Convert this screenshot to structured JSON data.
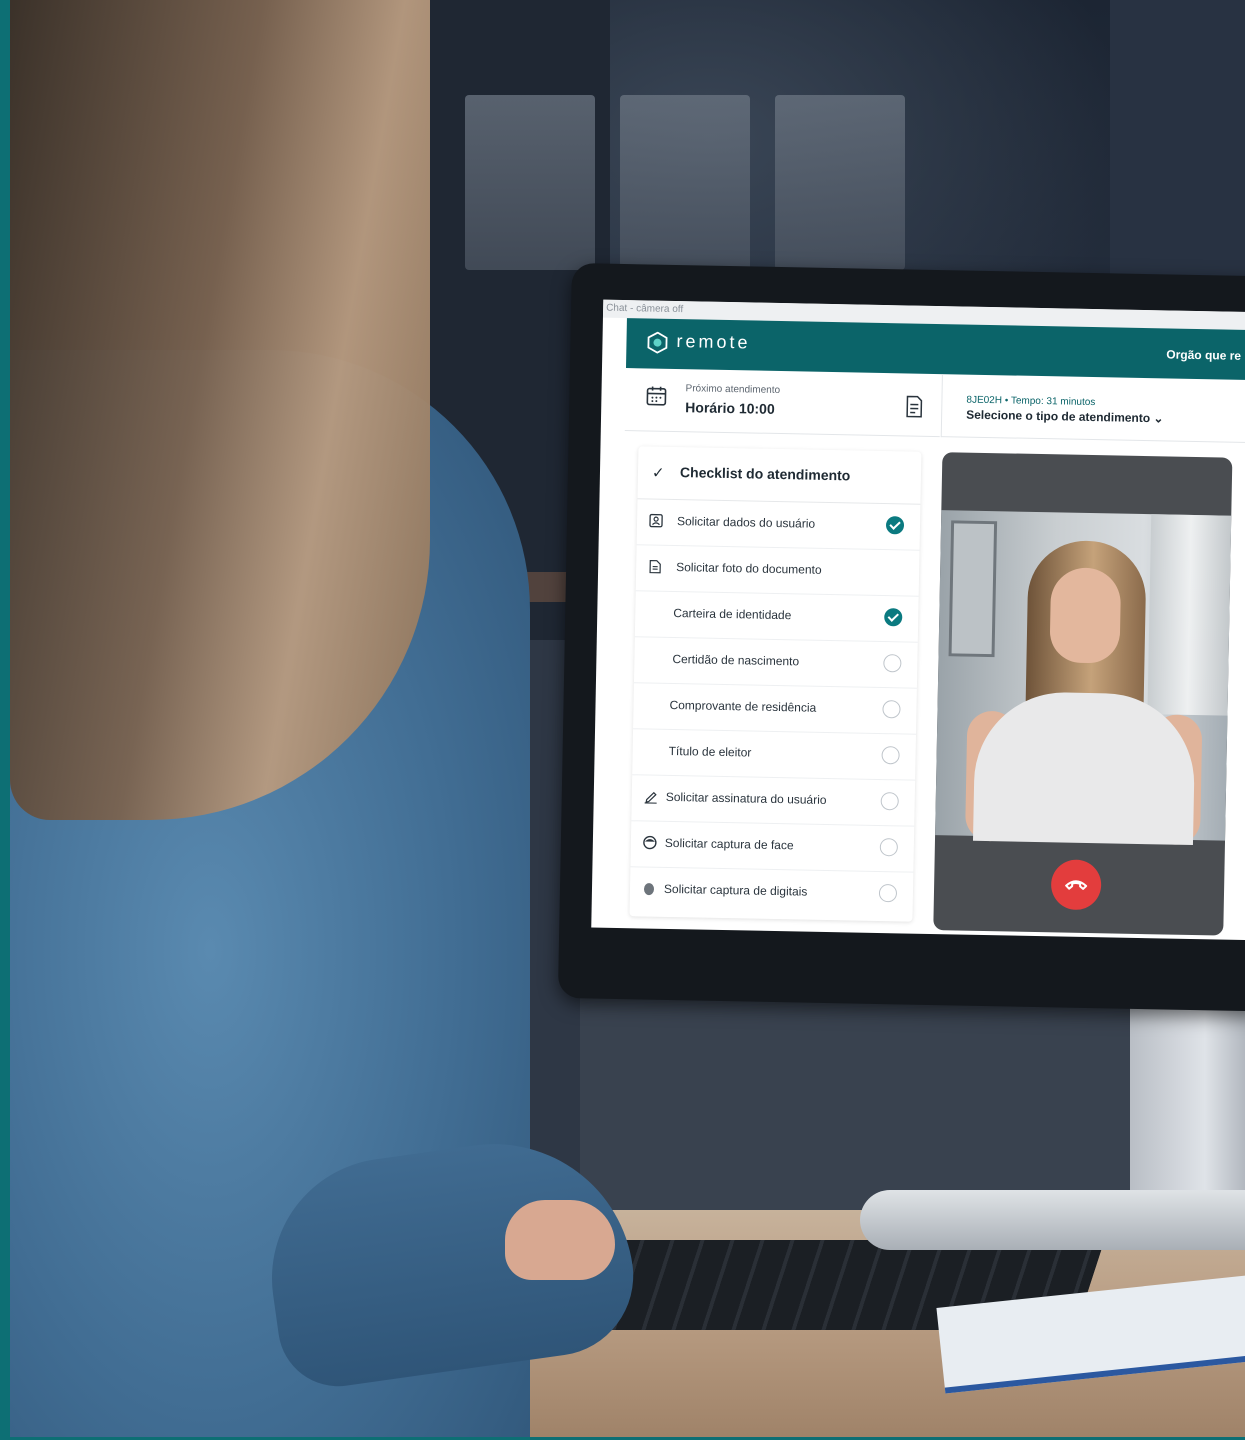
{
  "window": {
    "title": "Chat - câmera off"
  },
  "app": {
    "brand": "remote",
    "org_label": "Orgão que re",
    "accent_color": "#0b6469",
    "check_color": "#0b7a80",
    "hangup_color": "#e33d3d"
  },
  "next_appointment": {
    "label": "Próximo atendimento",
    "value": "Horário 10:00"
  },
  "session": {
    "info": "8JE02H • Tempo: 31 minutos",
    "type_select": "Selecione o tipo de atendimento ⌄"
  },
  "checklist": {
    "title": "Checklist do atendimento",
    "items": [
      {
        "label": "Solicitar dados do usuário",
        "icon": "user-card-icon",
        "checked": true
      },
      {
        "label": "Solicitar foto do documento",
        "icon": "document-icon",
        "checked": null
      },
      {
        "label": "Carteira de identidade",
        "icon": "",
        "checked": true
      },
      {
        "label": "Certidão de nascimento",
        "icon": "",
        "checked": false
      },
      {
        "label": "Comprovante de residência",
        "icon": "",
        "checked": false
      },
      {
        "label": "Título de eleitor",
        "icon": "",
        "checked": false
      },
      {
        "label": "Solicitar assinatura do usuário",
        "icon": "pen-icon",
        "checked": false
      },
      {
        "label": "Solicitar captura de face",
        "icon": "face-icon",
        "checked": false
      },
      {
        "label": "Solicitar captura de digitais",
        "icon": "fingerprint-icon",
        "checked": false
      }
    ]
  }
}
